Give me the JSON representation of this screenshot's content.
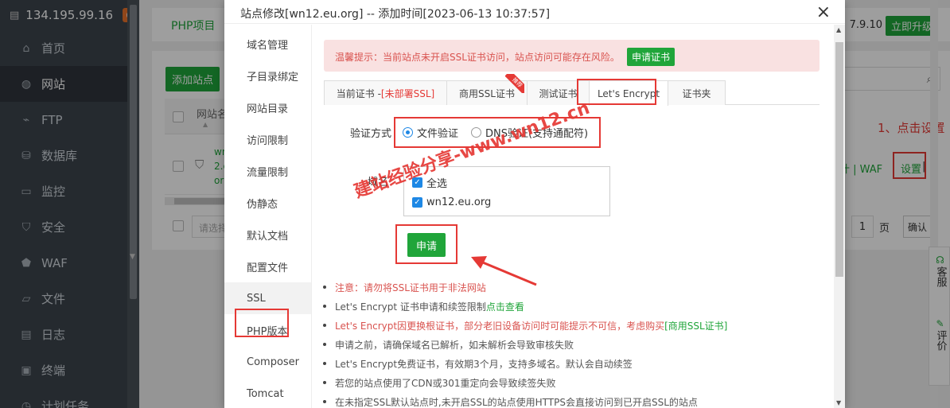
{
  "sidebar": {
    "ip": "134.195.99.16",
    "badge": "0",
    "items": [
      {
        "label": "首页",
        "icon": "home-icon"
      },
      {
        "label": "网站",
        "icon": "globe-icon"
      },
      {
        "label": "FTP",
        "icon": "ftp-icon"
      },
      {
        "label": "数据库",
        "icon": "database-icon"
      },
      {
        "label": "监控",
        "icon": "monitor-icon"
      },
      {
        "label": "安全",
        "icon": "shield-icon"
      },
      {
        "label": "WAF",
        "icon": "waf-icon"
      },
      {
        "label": "文件",
        "icon": "folder-icon"
      },
      {
        "label": "日志",
        "icon": "log-icon"
      },
      {
        "label": "终端",
        "icon": "terminal-icon"
      },
      {
        "label": "计划任务",
        "icon": "clock-icon"
      }
    ]
  },
  "main": {
    "php_tab": "PHP项目",
    "version": "7.9.10",
    "upgrade": "立即升级",
    "add_site": "添加站点",
    "col_site": "网站名",
    "row_site_lines": [
      "wn",
      "2.e",
      "or"
    ],
    "select_placeholder": "请选择",
    "actions": "计 | WAF",
    "settings": "设置",
    "settings_bar": "|",
    "annotation": "1、点击设置",
    "page_num": "1",
    "page_unit": "页",
    "confirm": "确认",
    "float": [
      {
        "label": "客服",
        "icon": "headset-icon"
      },
      {
        "label": "评价",
        "icon": "edit-icon"
      }
    ]
  },
  "modal": {
    "title": "站点修改[wn12.eu.org] -- 添加时间[2023-06-13 10:37:57]",
    "close": "×",
    "nav": [
      "域名管理",
      "子目录绑定",
      "网站目录",
      "访问限制",
      "流量限制",
      "伪静态",
      "默认文档",
      "配置文件",
      "SSL",
      "PHP版本",
      "Composer",
      "Tomcat"
    ],
    "warning": "温馨提示：当前站点未开启SSL证书访问，站点访问可能存在风险。",
    "warning_btn": "申请证书",
    "tabs": {
      "current_prefix": "当前证书 - ",
      "current_status": "[未部署SSL]",
      "commercial": "商用SSL证书",
      "recommend": "推荐",
      "test": "测试证书",
      "letsencrypt": "Let's Encrypt",
      "folder": "证书夹"
    },
    "verify_label": "验证方式",
    "verify_file": "文件验证",
    "verify_dns": "DNS验证(支持通配符)",
    "domain_label": "域名",
    "select_all": "全选",
    "domain": "wn12.eu.org",
    "apply_btn": "申请",
    "notes": [
      {
        "text": "注意：请勿将SSL证书用于非法网站",
        "red": true
      },
      {
        "text": "Let's Encrypt 证书申请和续签限制 ",
        "link": "点击查看"
      },
      {
        "text": "Let's Encrypt因更换根证书，部分老旧设备访问时可能提示不可信，考虑购买",
        "link": "[商用SSL证书]",
        "red": true
      },
      {
        "text": "申请之前，请确保域名已解析，如未解析会导致审核失败"
      },
      {
        "text": "Let's Encrypt免费证书，有效期3个月，支持多域名。默认会自动续签"
      },
      {
        "text": "若您的站点使用了CDN或301重定向会导致续签失败"
      },
      {
        "text": "在未指定SSL默认站点时,未开启SSL的站点使用HTTPS会直接访问到已开启SSL的站点"
      }
    ]
  },
  "watermark": "建站经验分享-www.wn12.cn",
  "colors": {
    "accent": "#20a53a",
    "annotation": "#e53935",
    "sidebar": "#3c444d"
  }
}
